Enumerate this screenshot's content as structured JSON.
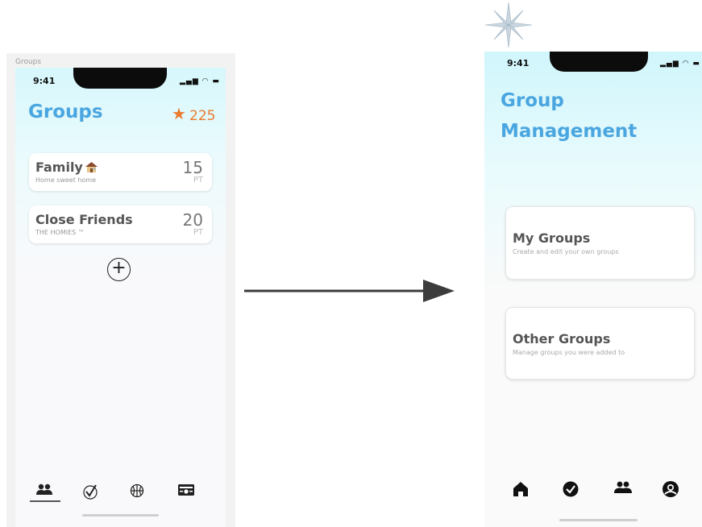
{
  "frame_label": "Groups",
  "left_screen": {
    "time": "9:41",
    "status": "▂▄▆ ◠ ▬",
    "title": "Groups",
    "points": "225",
    "groups": [
      {
        "name": "Family",
        "subtitle": "Home sweet home",
        "points": "15",
        "unit": "PT"
      },
      {
        "name": "Close Friends",
        "subtitle": "THE HOMIES ™",
        "points": "20",
        "unit": "PT"
      }
    ],
    "add_symbol": "+",
    "tabs": [
      {
        "icon": "groups-icon"
      },
      {
        "icon": "check-icon"
      },
      {
        "icon": "basketball-icon"
      },
      {
        "icon": "photo-icon"
      }
    ]
  },
  "right_screen": {
    "time": "9:41",
    "status": "▂▄▆ ◠ ▬",
    "title_line1": "Group",
    "title_line2": "Management",
    "options": [
      {
        "title": "My Groups",
        "subtitle": "Create and edit your own groups"
      },
      {
        "title": "Other Groups",
        "subtitle": "Manage groups you were added to"
      }
    ],
    "nav": [
      {
        "icon": "home-icon"
      },
      {
        "icon": "check-circle-icon"
      },
      {
        "icon": "groups-icon"
      },
      {
        "icon": "profile-icon"
      }
    ]
  },
  "colors": {
    "accent": "#4aa6e0",
    "points": "#ea7b2d"
  }
}
